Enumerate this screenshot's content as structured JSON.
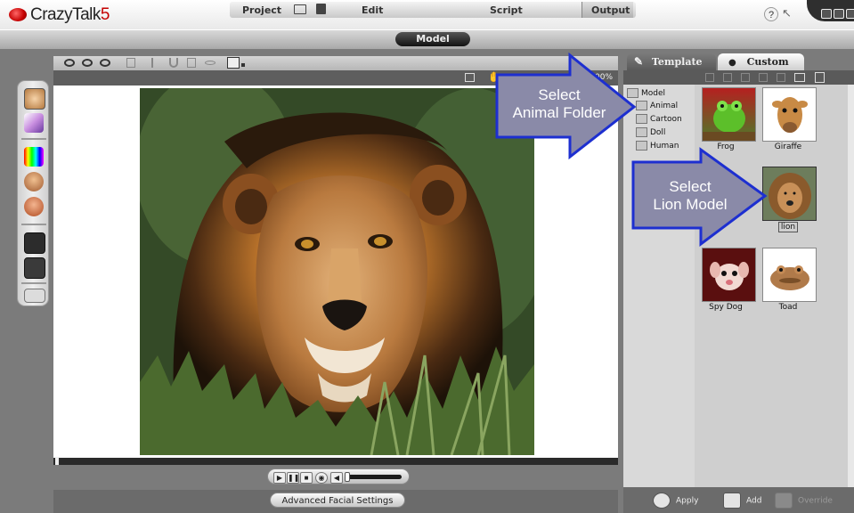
{
  "app": {
    "name": "CrazyTalk",
    "version": "5"
  },
  "modebar": {
    "project": "Project",
    "edit": "Edit",
    "model": "Model",
    "script": "Script",
    "output": "Output"
  },
  "viewport": {
    "zoom_label": "00%"
  },
  "advanced_button": "Advanced Facial Settings",
  "panel_tabs": {
    "template": "Template",
    "custom": "Custom"
  },
  "tree": {
    "root": "Model",
    "items": [
      "Animal",
      "Cartoon",
      "Doll",
      "Human"
    ]
  },
  "templates": [
    "Frog",
    "Giraffe",
    "lion",
    "Spy Dog",
    "Toad"
  ],
  "bottom_buttons": {
    "apply": "Apply",
    "add": "Add",
    "override": "Override"
  },
  "callouts": {
    "animal": {
      "line1": "Select",
      "line2": "Animal Folder"
    },
    "lion": {
      "line1": "Select",
      "line2": "Lion Model"
    }
  },
  "colors": {
    "callout_fill": "#8a8aa8",
    "callout_border": "#1d2fd0",
    "accent_red": "#c40000"
  }
}
